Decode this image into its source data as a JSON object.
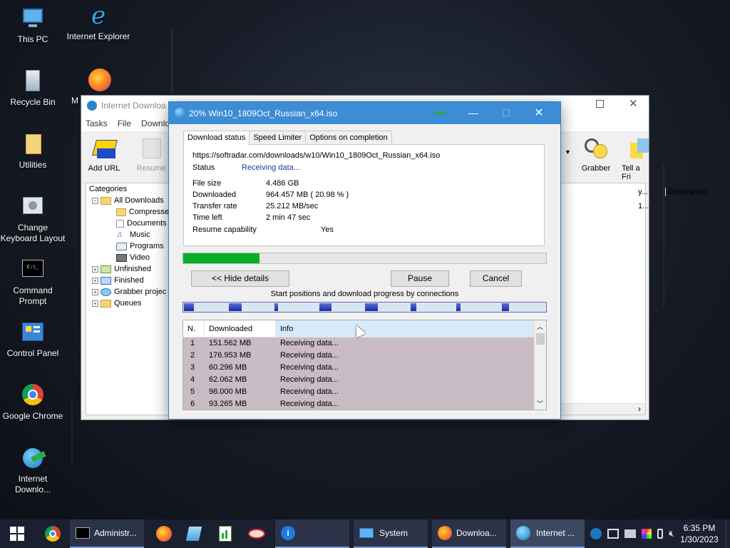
{
  "desktop": {
    "icons": [
      {
        "label": "This PC"
      },
      {
        "label": "Internet Explorer"
      },
      {
        "label": "Recycle Bin"
      },
      {
        "label": "M"
      },
      {
        "label": "Utilities"
      },
      {
        "label": "Change Keyboard Layout"
      },
      {
        "label": "Command Prompt"
      },
      {
        "label": "Control Panel"
      },
      {
        "label": "Google Chrome"
      },
      {
        "label": "Internet Downlo..."
      }
    ]
  },
  "idm_main": {
    "title": "Internet Downloa",
    "menu": [
      "Tasks",
      "File",
      "Downlo"
    ],
    "toolbar": {
      "add_url": "Add URL",
      "resume": "Resume",
      "grabber": "Grabber",
      "tell_friend": "Tell a Fri"
    },
    "categories_header": "Categories",
    "categories": [
      {
        "label": "All Downloads"
      },
      {
        "label": "Compresse"
      },
      {
        "label": "Documents"
      },
      {
        "label": "Music"
      },
      {
        "label": "Programs"
      },
      {
        "label": "Video"
      },
      {
        "label": "Unfinished"
      },
      {
        "label": "Finished"
      },
      {
        "label": "Grabber projec"
      },
      {
        "label": "Queues"
      }
    ],
    "filelist": {
      "col_partial": "y...",
      "col_description": "Description",
      "row_partial": "1..."
    }
  },
  "dialog": {
    "title": "20% Win10_1809Oct_Russian_x64.iso",
    "tabs": [
      "Download status",
      "Speed Limiter",
      "Options on completion"
    ],
    "url": "https://softradar.com/downloads/w10/Win10_1809Oct_Russian_x64.iso",
    "status_label": "Status",
    "status_value": "Receiving data...",
    "file_size_label": "File size",
    "file_size_value": "4.486  GB",
    "downloaded_label": "Downloaded",
    "downloaded_value": "964.457  MB  ( 20.98 % )",
    "transfer_rate_label": "Transfer rate",
    "transfer_rate_value": "25.212  MB/sec",
    "time_left_label": "Time left",
    "time_left_value": "2 min 47 sec",
    "resume_label": "Resume capability",
    "resume_value": "Yes",
    "progress_fraction": 0.2098,
    "buttons": {
      "hide_details": "<< Hide details",
      "pause": "Pause",
      "cancel": "Cancel"
    },
    "connections_label": "Start positions and download progress by connections",
    "table": {
      "headers": [
        "N.",
        "Downloaded",
        "Info"
      ],
      "rows": [
        {
          "n": "1",
          "downloaded": "151.562  MB",
          "info": "Receiving data..."
        },
        {
          "n": "2",
          "downloaded": "176.953  MB",
          "info": "Receiving data..."
        },
        {
          "n": "3",
          "downloaded": "60.296  MB",
          "info": "Receiving data..."
        },
        {
          "n": "4",
          "downloaded": "62.062  MB",
          "info": "Receiving data..."
        },
        {
          "n": "5",
          "downloaded": "98.000  MB",
          "info": "Receiving data..."
        },
        {
          "n": "6",
          "downloaded": "93.265  MB",
          "info": "Receiving data..."
        }
      ]
    }
  },
  "taskbar": {
    "items": [
      {
        "label": "Administr..."
      },
      {
        "label": "System"
      },
      {
        "label": "Downloa..."
      },
      {
        "label": "Internet ..."
      }
    ],
    "clock_time": "6:35 PM",
    "clock_date": "1/30/2023"
  },
  "colors": {
    "title_active": "#3c8cd6",
    "progress_green": "#06b025",
    "row_bg": "#c9bcc4"
  }
}
